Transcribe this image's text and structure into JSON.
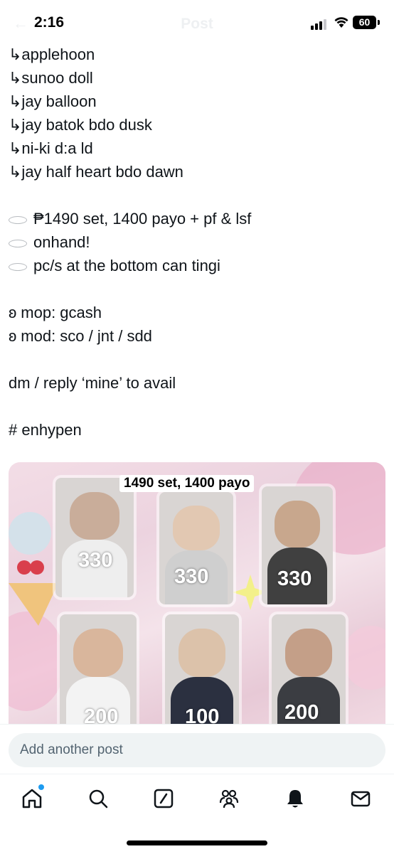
{
  "status": {
    "time": "2:16",
    "battery": "60"
  },
  "header": {
    "title": "Post"
  },
  "tweet": {
    "lines": [
      "↳applehoon",
      "↳sunoo doll",
      "↳jay balloon",
      "↳jay batok bdo dusk",
      "↳ni-ki d:a ld",
      "↳jay half heart bdo dawn",
      "₱1490 set, 1400 payo + pf & lsf",
      "onhand!",
      "pc/s at the bottom can tingi",
      "ʚ mop: gcash",
      "ʚ mod: sco / jnt / sdd",
      "dm / reply ‘mine’ to avail",
      "# enhypen"
    ]
  },
  "photo": {
    "label": "1490 set, 1400 payo",
    "prices": [
      "330",
      "330",
      "330",
      "200",
      "100",
      "200"
    ]
  },
  "reply": {
    "placeholder": "Add another post"
  },
  "nav": {
    "items": [
      "home-icon",
      "search-icon",
      "grok-icon",
      "communities-icon",
      "notifications-icon",
      "messages-icon"
    ]
  },
  "colors": {
    "accent": "#1d9bf0",
    "text": "#0f1419",
    "muted": "#536471"
  }
}
